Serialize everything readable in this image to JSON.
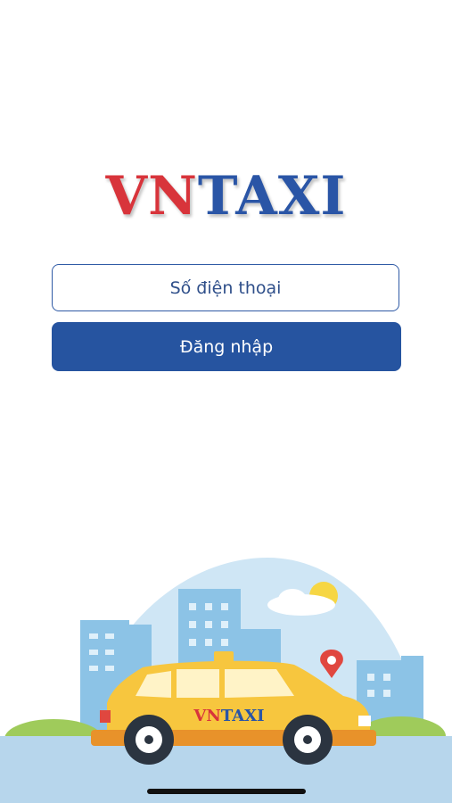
{
  "logo": {
    "part1": "VN",
    "part2": "TAXI"
  },
  "login_form": {
    "phone_placeholder": "Số điện thoại",
    "login_label": "Đăng nhập"
  },
  "illustration": {
    "taxi_brand_part1": "VN",
    "taxi_brand_part2": "TAXI"
  },
  "colors": {
    "brand_red": "#d8343b",
    "brand_blue": "#2a55a6",
    "button_blue": "#2654a0"
  }
}
